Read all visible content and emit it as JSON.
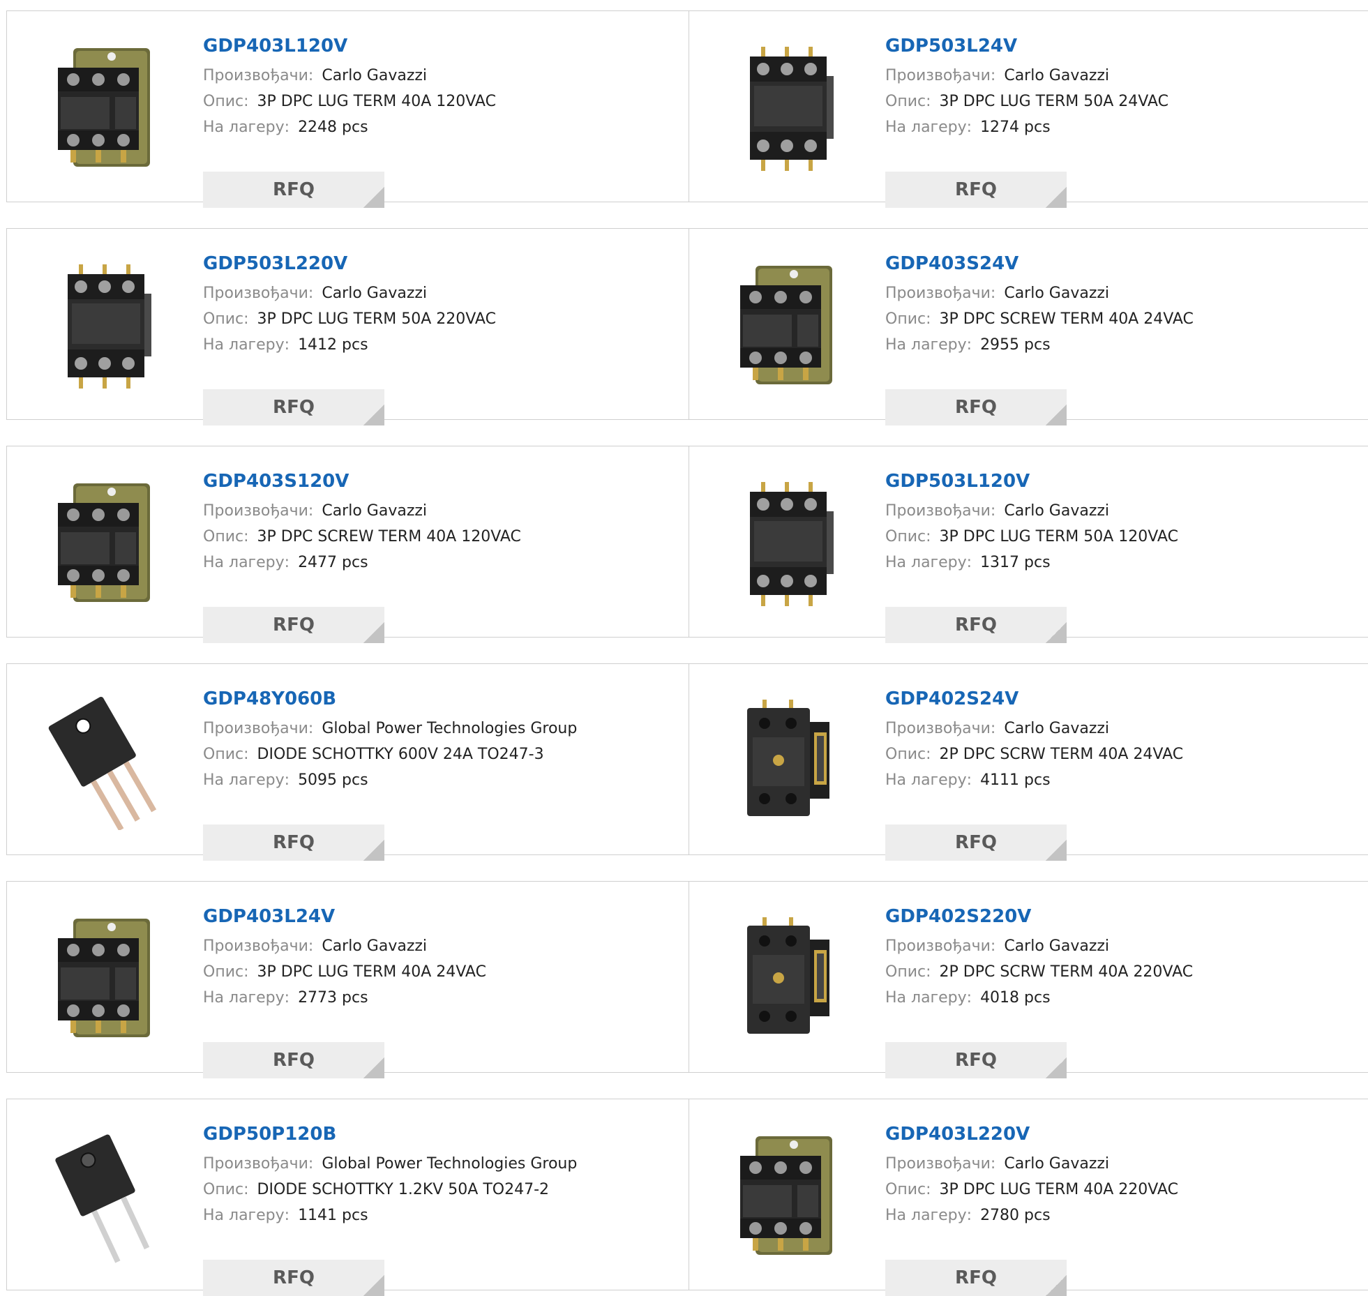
{
  "labels": {
    "manufacturer": "Произвођачи:",
    "description": "Опис:",
    "stock": "На лагеру:",
    "rfq": "RFQ"
  },
  "products": [
    {
      "part": "GDP403L120V",
      "manufacturer": "Carlo Gavazzi",
      "description": "3P DPC LUG TERM 40A 120VAC",
      "stock": "2248 pcs",
      "image": "contactor-3pole-bracket"
    },
    {
      "part": "GDP503L24V",
      "manufacturer": "Carlo Gavazzi",
      "description": "3P DPC LUG TERM 50A 24VAC",
      "stock": "1274 pcs",
      "image": "contactor-3pole"
    },
    {
      "part": "GDP503L220V",
      "manufacturer": "Carlo Gavazzi",
      "description": "3P DPC LUG TERM 50A 220VAC",
      "stock": "1412 pcs",
      "image": "contactor-3pole"
    },
    {
      "part": "GDP403S24V",
      "manufacturer": "Carlo Gavazzi",
      "description": "3P DPC SCREW TERM 40A 24VAC",
      "stock": "2955 pcs",
      "image": "contactor-3pole-bracket"
    },
    {
      "part": "GDP403S120V",
      "manufacturer": "Carlo Gavazzi",
      "description": "3P DPC SCREW TERM 40A 120VAC",
      "stock": "2477 pcs",
      "image": "contactor-3pole-bracket"
    },
    {
      "part": "GDP503L120V",
      "manufacturer": "Carlo Gavazzi",
      "description": "3P DPC LUG TERM 50A 120VAC",
      "stock": "1317 pcs",
      "image": "contactor-3pole"
    },
    {
      "part": "GDP48Y060B",
      "manufacturer": "Global Power Technologies Group",
      "description": "DIODE SCHOTTKY 600V 24A TO247-3",
      "stock": "5095 pcs",
      "image": "to247-3"
    },
    {
      "part": "GDP402S24V",
      "manufacturer": "Carlo Gavazzi",
      "description": "2P DPC SCRW TERM 40A 24VAC",
      "stock": "4111 pcs",
      "image": "contactor-2pole"
    },
    {
      "part": "GDP403L24V",
      "manufacturer": "Carlo Gavazzi",
      "description": "3P DPC LUG TERM 40A 24VAC",
      "stock": "2773 pcs",
      "image": "contactor-3pole-bracket"
    },
    {
      "part": "GDP402S220V",
      "manufacturer": "Carlo Gavazzi",
      "description": "2P DPC SCRW TERM 40A 220VAC",
      "stock": "4018 pcs",
      "image": "contactor-2pole"
    },
    {
      "part": "GDP50P120B",
      "manufacturer": "Global Power Technologies Group",
      "description": "DIODE SCHOTTKY 1.2KV 50A TO247-2",
      "stock": "1141 pcs",
      "image": "to247-2"
    },
    {
      "part": "GDP403L220V",
      "manufacturer": "Carlo Gavazzi",
      "description": "3P DPC LUG TERM 40A 220VAC",
      "stock": "2780 pcs",
      "image": "contactor-3pole-bracket"
    }
  ],
  "colors": {
    "link": "#1766b5",
    "label": "#8a8a8a",
    "value": "#222222",
    "button_bg": "#ededed",
    "button_text": "#5a5a5a",
    "border": "#cfcfcf"
  }
}
